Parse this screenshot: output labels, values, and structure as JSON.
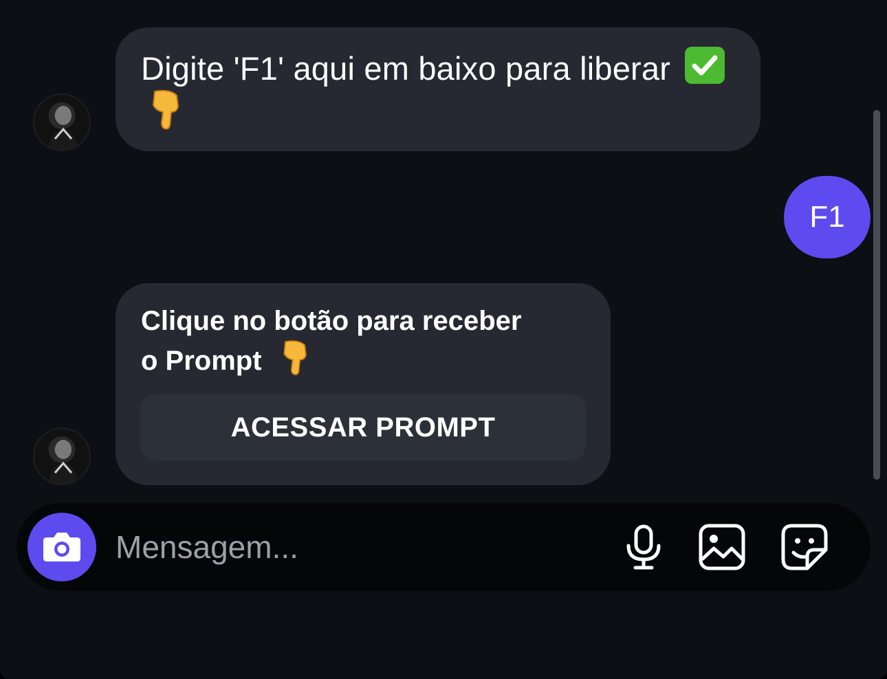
{
  "colors": {
    "background": "#0c0f14",
    "incoming_bubble": "#262931",
    "outgoing_bubble": "#5d4bf0",
    "accent": "#5d4bf0"
  },
  "messages": {
    "msg1": {
      "text": "Digite 'F1' aqui em baixo para liberar",
      "check_emoji": "✅",
      "point_emoji": "👇"
    },
    "msg2": {
      "line1": "Clique no botão para receber",
      "line2": "o Prompt",
      "point_emoji": "👇",
      "button_label": "ACESSAR PROMPT"
    },
    "outgoing": {
      "text": "F1"
    }
  },
  "composer": {
    "placeholder": "Mensagem...",
    "icons": [
      "camera-icon",
      "microphone-icon",
      "image-icon",
      "sticker-icon"
    ]
  }
}
